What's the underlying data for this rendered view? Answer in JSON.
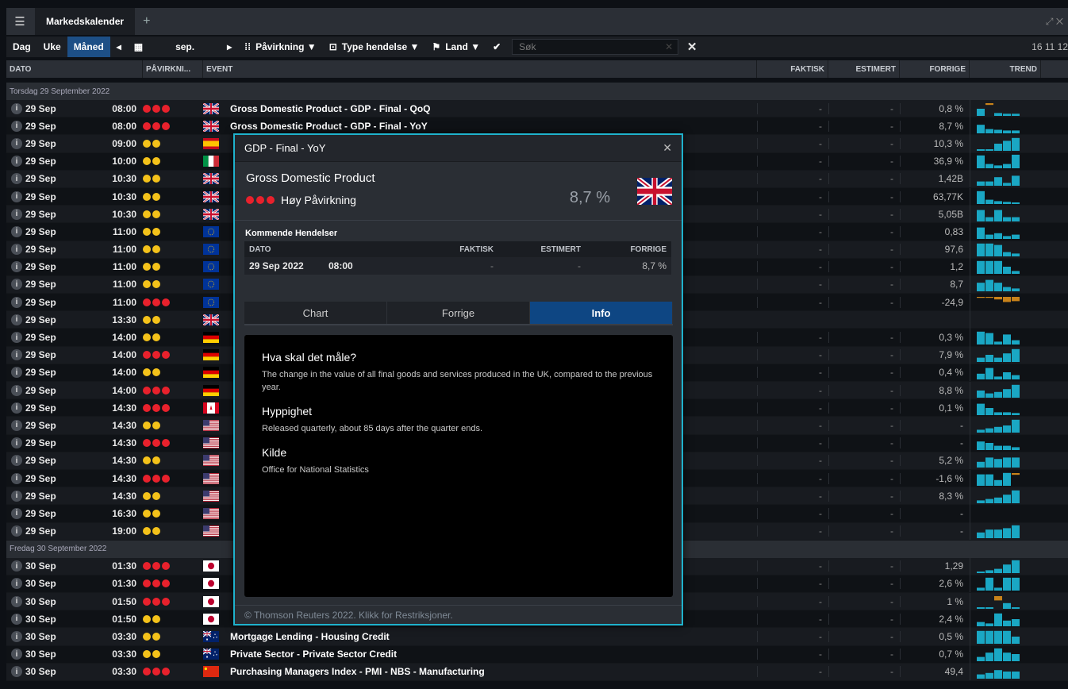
{
  "window": {
    "tab_title": "Markedskalender",
    "right_text": "⤢ ✕"
  },
  "toolbar": {
    "day": "Dag",
    "week": "Uke",
    "month": "Måned",
    "period": "sep.",
    "impact_filter": "Påvirkning ▼",
    "event_type_filter": "Type hendelse ▼",
    "country_filter": "Land ▼",
    "search_placeholder": "Søk",
    "time": "16 11 12"
  },
  "columns": {
    "date": "DATO",
    "impact": "PÅVIRKNI...",
    "event": "EVENT",
    "actual": "FAKTISK",
    "estimate": "ESTIMERT",
    "previous": "FORRIGE",
    "trend": "TREND"
  },
  "groups": {
    "g1": "Torsdag 29 September 2022",
    "g2": "Fredag 30 September 2022"
  },
  "rows1": [
    {
      "date": "29 Sep",
      "time": "08:00",
      "impact": 3,
      "flag": "gb",
      "event": "Gross Domestic Product - GDP - Final - QoQ",
      "actual": "-",
      "estimate": "-",
      "previous": "0,8 %",
      "trend": [
        0.5,
        0.2,
        0.2,
        0.15,
        0.15
      ],
      "neg": [
        0,
        1,
        0,
        0,
        0
      ]
    },
    {
      "date": "29 Sep",
      "time": "08:00",
      "impact": 3,
      "flag": "gb",
      "event": "Gross Domestic Product - GDP - Final - YoY",
      "actual": "-",
      "estimate": "-",
      "previous": "8,7 %",
      "trend": [
        0.6,
        0.3,
        0.25,
        0.2,
        0.2
      ],
      "neg": [
        0,
        0,
        0,
        0,
        0
      ]
    },
    {
      "date": "29 Sep",
      "time": "09:00",
      "impact": 2,
      "flag": "es",
      "event": "",
      "actual": "-",
      "estimate": "-",
      "previous": "10,3 %",
      "trend": [
        0.1,
        0.1,
        0.5,
        0.7,
        0.9
      ],
      "neg": [
        0,
        0,
        0,
        0,
        0
      ]
    },
    {
      "date": "29 Sep",
      "time": "10:00",
      "impact": 2,
      "flag": "it",
      "event": "",
      "actual": "-",
      "estimate": "-",
      "previous": "36,9 %",
      "trend": [
        0.9,
        0.3,
        0.2,
        0.3,
        0.95
      ],
      "neg": [
        0,
        0,
        0,
        0,
        0
      ]
    },
    {
      "date": "29 Sep",
      "time": "10:30",
      "impact": 2,
      "flag": "gb",
      "event": "",
      "actual": "-",
      "estimate": "-",
      "previous": "1,42B",
      "trend": [
        0.3,
        0.3,
        0.6,
        0.2,
        0.7
      ],
      "neg": [
        0,
        0,
        0,
        0,
        0
      ]
    },
    {
      "date": "29 Sep",
      "time": "10:30",
      "impact": 2,
      "flag": "gb",
      "event": "",
      "actual": "-",
      "estimate": "-",
      "previous": "63,77K",
      "trend": [
        0.9,
        0.3,
        0.2,
        0.15,
        0.1
      ],
      "neg": [
        0,
        0,
        0,
        0,
        0
      ]
    },
    {
      "date": "29 Sep",
      "time": "10:30",
      "impact": 2,
      "flag": "gb",
      "event": "",
      "actual": "-",
      "estimate": "-",
      "previous": "5,05B",
      "trend": [
        0.8,
        0.3,
        0.8,
        0.3,
        0.3
      ],
      "neg": [
        0,
        0,
        0,
        0,
        0
      ]
    },
    {
      "date": "29 Sep",
      "time": "11:00",
      "impact": 2,
      "flag": "eu",
      "event": "",
      "actual": "-",
      "estimate": "-",
      "previous": "0,83",
      "trend": [
        0.8,
        0.3,
        0.4,
        0.2,
        0.3
      ],
      "neg": [
        0,
        0,
        0,
        0,
        0
      ]
    },
    {
      "date": "29 Sep",
      "time": "11:00",
      "impact": 2,
      "flag": "eu",
      "event": "",
      "actual": "-",
      "estimate": "-",
      "previous": "97,6",
      "trend": [
        0.9,
        0.9,
        0.8,
        0.3,
        0.2
      ],
      "neg": [
        0,
        0,
        0,
        0,
        0
      ]
    },
    {
      "date": "29 Sep",
      "time": "11:00",
      "impact": 2,
      "flag": "eu",
      "event": "",
      "actual": "-",
      "estimate": "-",
      "previous": "1,2",
      "trend": [
        0.9,
        0.9,
        0.9,
        0.5,
        0.2
      ],
      "neg": [
        0,
        0,
        0,
        0,
        0
      ]
    },
    {
      "date": "29 Sep",
      "time": "11:00",
      "impact": 2,
      "flag": "eu",
      "event": "",
      "actual": "-",
      "estimate": "-",
      "previous": "8,7",
      "trend": [
        0.6,
        0.8,
        0.6,
        0.3,
        0.2
      ],
      "neg": [
        0,
        0,
        0,
        0,
        0
      ]
    },
    {
      "date": "29 Sep",
      "time": "11:00",
      "impact": 3,
      "flag": "eu",
      "event": "",
      "actual": "-",
      "estimate": "-",
      "previous": "-24,9",
      "trend": [
        0.1,
        0.1,
        0.3,
        0.6,
        0.5
      ],
      "neg": [
        1,
        1,
        1,
        1,
        1
      ]
    },
    {
      "date": "29 Sep",
      "time": "13:30",
      "impact": 2,
      "flag": "gb",
      "event": "",
      "actual": "",
      "estimate": "",
      "previous": "",
      "trend": [],
      "neg": []
    },
    {
      "date": "29 Sep",
      "time": "14:00",
      "impact": 2,
      "flag": "de",
      "event": "",
      "actual": "-",
      "estimate": "-",
      "previous": "0,3 %",
      "trend": [
        0.9,
        0.8,
        0.2,
        0.7,
        0.3
      ],
      "neg": [
        0,
        0,
        0,
        0,
        0
      ]
    },
    {
      "date": "29 Sep",
      "time": "14:00",
      "impact": 3,
      "flag": "de",
      "event": "",
      "actual": "-",
      "estimate": "-",
      "previous": "7,9 %",
      "trend": [
        0.3,
        0.5,
        0.3,
        0.6,
        0.9
      ],
      "neg": [
        0,
        0,
        0,
        0,
        0
      ]
    },
    {
      "date": "29 Sep",
      "time": "14:00",
      "impact": 2,
      "flag": "de",
      "event": "",
      "actual": "-",
      "estimate": "-",
      "previous": "0,4 %",
      "trend": [
        0.4,
        0.8,
        0.2,
        0.5,
        0.3
      ],
      "neg": [
        0,
        0,
        0,
        0,
        0
      ]
    },
    {
      "date": "29 Sep",
      "time": "14:00",
      "impact": 3,
      "flag": "de",
      "event": "",
      "actual": "-",
      "estimate": "-",
      "previous": "8,8 %",
      "trend": [
        0.5,
        0.3,
        0.4,
        0.6,
        0.9
      ],
      "neg": [
        0,
        0,
        0,
        0,
        0
      ]
    },
    {
      "date": "29 Sep",
      "time": "14:30",
      "impact": 3,
      "flag": "ca",
      "event": "",
      "actual": "-",
      "estimate": "-",
      "previous": "0,1 %",
      "trend": [
        0.8,
        0.5,
        0.2,
        0.2,
        0.15
      ],
      "neg": [
        0,
        0,
        0,
        0,
        0
      ]
    },
    {
      "date": "29 Sep",
      "time": "14:30",
      "impact": 2,
      "flag": "us",
      "event": "",
      "actual": "-",
      "estimate": "-",
      "previous": "-",
      "trend": [
        0.2,
        0.3,
        0.4,
        0.5,
        0.9
      ],
      "neg": [
        0,
        0,
        0,
        0,
        0
      ]
    },
    {
      "date": "29 Sep",
      "time": "14:30",
      "impact": 3,
      "flag": "us",
      "event": "",
      "actual": "-",
      "estimate": "-",
      "previous": "-",
      "trend": [
        0.6,
        0.5,
        0.3,
        0.3,
        0.2
      ],
      "neg": [
        0,
        0,
        0,
        0,
        0
      ]
    },
    {
      "date": "29 Sep",
      "time": "14:30",
      "impact": 2,
      "flag": "us",
      "event": "",
      "actual": "-",
      "estimate": "-",
      "previous": "5,2 %",
      "trend": [
        0.4,
        0.7,
        0.6,
        0.7,
        0.7
      ],
      "neg": [
        0,
        0,
        0,
        0,
        0
      ]
    },
    {
      "date": "29 Sep",
      "time": "14:30",
      "impact": 3,
      "flag": "us",
      "event": "",
      "actual": "-",
      "estimate": "-",
      "previous": "-1,6 %",
      "trend": [
        0.8,
        0.8,
        0.4,
        0.9,
        0.2
      ],
      "neg": [
        0,
        0,
        0,
        0,
        1
      ]
    },
    {
      "date": "29 Sep",
      "time": "14:30",
      "impact": 2,
      "flag": "us",
      "event": "",
      "actual": "-",
      "estimate": "-",
      "previous": "8,3 %",
      "trend": [
        0.2,
        0.3,
        0.4,
        0.6,
        0.9
      ],
      "neg": [
        0,
        0,
        0,
        0,
        0
      ]
    },
    {
      "date": "29 Sep",
      "time": "16:30",
      "impact": 2,
      "flag": "us",
      "event": "",
      "actual": "-",
      "estimate": "-",
      "previous": "-",
      "trend": [],
      "neg": []
    },
    {
      "date": "29 Sep",
      "time": "19:00",
      "impact": 2,
      "flag": "us",
      "event": "",
      "actual": "-",
      "estimate": "-",
      "previous": "-",
      "trend": [
        0.4,
        0.6,
        0.6,
        0.7,
        0.9
      ],
      "neg": [
        0,
        0,
        0,
        0,
        0
      ]
    }
  ],
  "rows2": [
    {
      "date": "30 Sep",
      "time": "01:30",
      "impact": 3,
      "flag": "jp",
      "event": "",
      "actual": "-",
      "estimate": "-",
      "previous": "1,29",
      "trend": [
        0.1,
        0.2,
        0.3,
        0.6,
        0.9
      ],
      "neg": [
        0,
        0,
        0,
        0,
        0
      ]
    },
    {
      "date": "30 Sep",
      "time": "01:30",
      "impact": 3,
      "flag": "jp",
      "event": "",
      "actual": "-",
      "estimate": "-",
      "previous": "2,6 %",
      "trend": [
        0.2,
        0.9,
        0.2,
        0.9,
        0.9
      ],
      "neg": [
        0,
        0,
        0,
        0,
        0
      ]
    },
    {
      "date": "30 Sep",
      "time": "01:50",
      "impact": 3,
      "flag": "jp",
      "event": "",
      "actual": "-",
      "estimate": "-",
      "previous": "1 %",
      "trend": [
        0.1,
        0.1,
        0.5,
        0.4,
        0.1
      ],
      "neg": [
        0,
        0,
        1,
        0,
        0
      ]
    },
    {
      "date": "30 Sep",
      "time": "01:50",
      "impact": 2,
      "flag": "jp",
      "event": "",
      "actual": "-",
      "estimate": "-",
      "previous": "2,4 %",
      "trend": [
        0.3,
        0.2,
        0.9,
        0.4,
        0.5
      ],
      "neg": [
        0,
        0,
        0,
        0,
        0
      ]
    },
    {
      "date": "30 Sep",
      "time": "03:30",
      "impact": 2,
      "flag": "au",
      "event": "Mortgage Lending - Housing Credit",
      "actual": "-",
      "estimate": "-",
      "previous": "0,5 %",
      "trend": [
        0.9,
        0.9,
        0.9,
        0.9,
        0.5
      ],
      "neg": [
        0,
        0,
        0,
        0,
        0
      ]
    },
    {
      "date": "30 Sep",
      "time": "03:30",
      "impact": 2,
      "flag": "au",
      "event": "Private Sector - Private Sector Credit",
      "actual": "-",
      "estimate": "-",
      "previous": "0,7 %",
      "trend": [
        0.3,
        0.6,
        0.9,
        0.6,
        0.5
      ],
      "neg": [
        0,
        0,
        0,
        0,
        0
      ]
    },
    {
      "date": "30 Sep",
      "time": "03:30",
      "impact": 3,
      "flag": "cn",
      "event": "Purchasing Managers Index - PMI - NBS - Manufacturing",
      "actual": "-",
      "estimate": "-",
      "previous": "49,4",
      "trend": [
        0.3,
        0.4,
        0.6,
        0.5,
        0.5
      ],
      "neg": [
        0,
        0,
        0,
        0,
        0
      ]
    }
  ],
  "dialog": {
    "title": "GDP - Final - YoY",
    "name": "Gross Domestic Product",
    "impact_label": "Høy Påvirkning",
    "value": "8,7 %",
    "upcoming_title": "Kommende Hendelser",
    "up_cols": {
      "date": "DATO",
      "actual": "FAKTISK",
      "estimate": "ESTIMERT",
      "previous": "FORRIGE"
    },
    "up_row": {
      "date": "29 Sep 2022",
      "time": "08:00",
      "actual": "-",
      "estimate": "-",
      "previous": "8,7 %"
    },
    "tabs": [
      "Chart",
      "Forrige",
      "Info"
    ],
    "info": {
      "h1": "Hva skal det måle?",
      "p1": "The change in the value of all final goods and services produced in the UK, compared to the previous year.",
      "h2": "Hyppighet",
      "p2": "Released quarterly, about 85 days after the quarter ends.",
      "h3": "Kilde",
      "p3": "Office for National Statistics"
    },
    "footer": "© Thomson Reuters 2022. Klikk for Restriksjoner."
  },
  "colors": {
    "accent": "#1d4f86",
    "trend_pos": "#1aa7c4",
    "trend_neg": "#c8821a",
    "dialog_border": "#1fb2cc"
  }
}
